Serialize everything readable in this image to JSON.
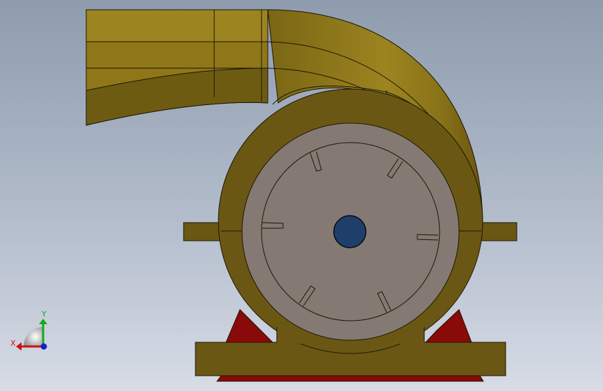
{
  "view": {
    "background_top": "#8e9cad",
    "background_bottom": "#d7dce6"
  },
  "model": {
    "casing_color": "#6b5714",
    "scroll_color": "#8a7318",
    "scroll_highlight": "#a88f22",
    "rotor_color": "#857a73",
    "shaft_color": "#1f3f6b",
    "support_color": "#8a0909",
    "edge_color": "#1a1505"
  },
  "triad": {
    "x_label": "X",
    "y_label": "Y",
    "x_color": "#cc1111",
    "y_color": "#11aa22",
    "z_color": "#1122cc"
  }
}
